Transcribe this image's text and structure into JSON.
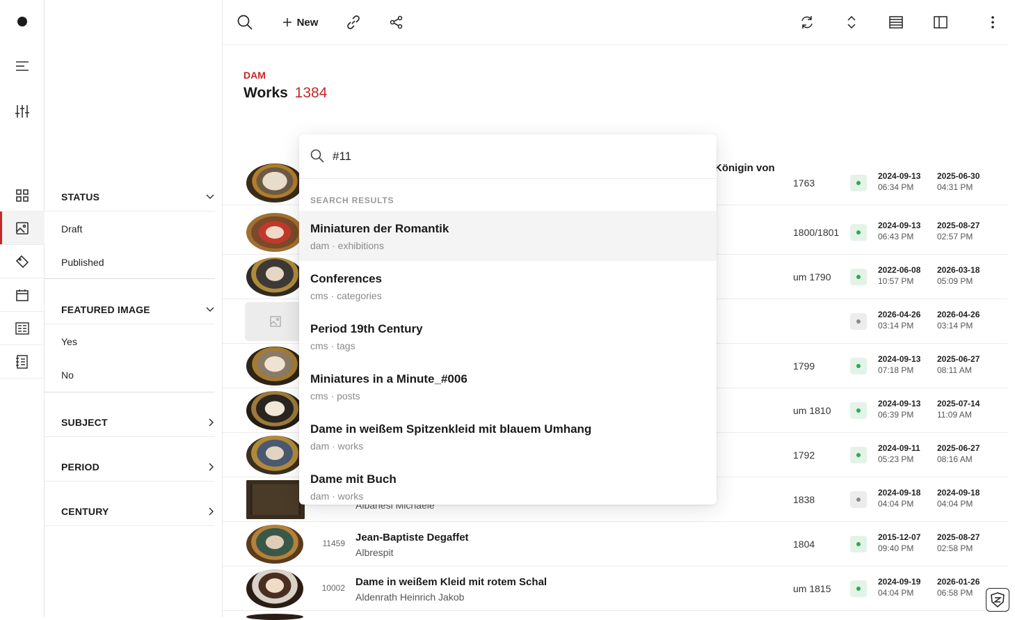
{
  "toolbar": {
    "new_label": "New"
  },
  "header": {
    "eyebrow": "DAM",
    "title": "Works",
    "count": "1384"
  },
  "filters": {
    "status": {
      "label": "STATUS",
      "options": [
        "Draft",
        "Published"
      ]
    },
    "featured_image": {
      "label": "FEATURED IMAGE",
      "options": [
        "Yes",
        "No"
      ]
    },
    "subject": {
      "label": "SUBJECT"
    },
    "period": {
      "label": "PERIOD"
    },
    "century": {
      "label": "CENTURY"
    }
  },
  "rows": [
    {
      "id": "",
      "title": "Königin von",
      "artist": "",
      "date": "1763",
      "status": "published",
      "created_date": "2024-09-13",
      "created_time": "06:34 PM",
      "updated_date": "2025-06-30",
      "updated_time": "04:31 PM"
    },
    {
      "id": "",
      "title": "",
      "artist": "",
      "date": "1800/1801",
      "status": "published",
      "created_date": "2024-09-13",
      "created_time": "06:43 PM",
      "updated_date": "2025-08-27",
      "updated_time": "02:57 PM"
    },
    {
      "id": "",
      "title": "",
      "artist": "",
      "date": "um 1790",
      "status": "published",
      "created_date": "2022-06-08",
      "created_time": "10:57 PM",
      "updated_date": "2026-03-18",
      "updated_time": "05:09 PM"
    },
    {
      "id": "",
      "title": "",
      "artist": "",
      "date": "",
      "status": "draft",
      "created_date": "2026-04-26",
      "created_time": "03:14 PM",
      "updated_date": "2026-04-26",
      "updated_time": "03:14 PM"
    },
    {
      "id": "",
      "title": "",
      "artist": "",
      "date": "1799",
      "status": "published",
      "created_date": "2024-09-13",
      "created_time": "07:18 PM",
      "updated_date": "2025-06-27",
      "updated_time": "08:11 AM"
    },
    {
      "id": "",
      "title": "",
      "artist": "",
      "date": "um 1810",
      "status": "published",
      "created_date": "2024-09-13",
      "created_time": "06:39 PM",
      "updated_date": "2025-07-14",
      "updated_time": "11:09 AM"
    },
    {
      "id": "",
      "title": "",
      "artist": "",
      "date": "1792",
      "status": "published",
      "created_date": "2024-09-11",
      "created_time": "05:23 PM",
      "updated_date": "2025-06-27",
      "updated_time": "08:16 AM"
    },
    {
      "id": "",
      "title": "",
      "artist": "Albanesi Michaele",
      "date": "1838",
      "status": "draft",
      "created_date": "2024-09-18",
      "created_time": "04:04 PM",
      "updated_date": "2024-09-18",
      "updated_time": "04:04 PM"
    },
    {
      "id": "11459",
      "title": "Jean-Baptiste Degaffet",
      "artist": "Albrespit",
      "date": "1804",
      "status": "published",
      "created_date": "2015-12-07",
      "created_time": "09:40 PM",
      "updated_date": "2025-08-27",
      "updated_time": "02:58 PM"
    },
    {
      "id": "10002",
      "title": "Dame in weißem Kleid mit rotem Schal",
      "artist": "Aldenrath Heinrich Jakob",
      "date": "um 1815",
      "status": "published",
      "created_date": "2024-09-19",
      "created_time": "04:04 PM",
      "updated_date": "2026-01-26",
      "updated_time": "06:58 PM"
    }
  ],
  "search": {
    "query": "#11",
    "results_label": "SEARCH RESULTS",
    "results": [
      {
        "title": "Miniaturen der Romantik",
        "source": "dam · exhibitions"
      },
      {
        "title": "Conferences",
        "source": "cms · categories"
      },
      {
        "title": "Period 19th Century",
        "source": "cms · tags"
      },
      {
        "title": "Miniatures in a Minute_#006",
        "source": "cms · posts"
      },
      {
        "title": "Dame in weißem Spitzenkleid mit blauem Umhang",
        "source": "dam · works"
      },
      {
        "title": "Dame mit Buch",
        "source": "dam · works"
      }
    ]
  },
  "colors": {
    "accent": "#c62828",
    "published": "#2ea84f",
    "draft": "#8a8a8a"
  }
}
